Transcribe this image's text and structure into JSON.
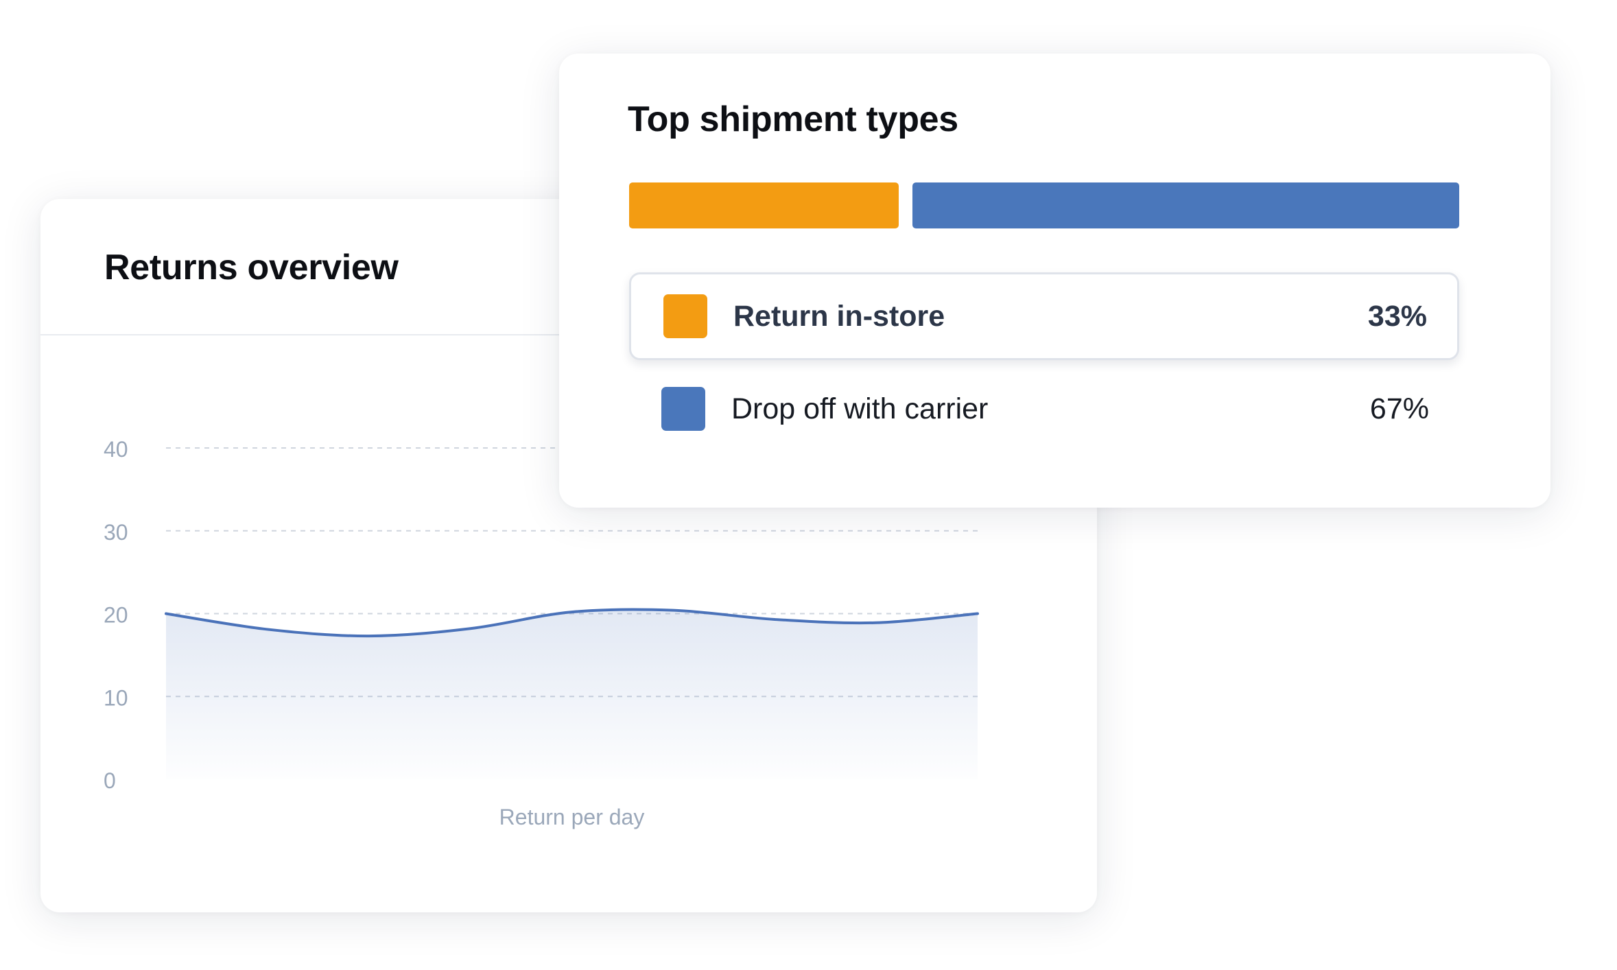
{
  "returns_overview": {
    "title": "Returns overview"
  },
  "chart_data": {
    "type": "area",
    "title": "Returns overview",
    "xlabel": "Return per day",
    "ylabel": "",
    "ylim": [
      0,
      40
    ],
    "yticks": [
      "40",
      "30",
      "20",
      "10",
      "0"
    ],
    "grid": true,
    "legend": "none",
    "line_color": "#4a72b9",
    "x": [
      0,
      1,
      2,
      3,
      4,
      5,
      6,
      7,
      8
    ],
    "series": [
      {
        "values": [
          20.0,
          18.1,
          17.3,
          18.2,
          20.2,
          20.4,
          19.3,
          18.9,
          20.0
        ]
      }
    ]
  },
  "shipment_types": {
    "title": "Top shipment types",
    "items": [
      {
        "label": "Return in-store",
        "percent": "33%",
        "share": 0.33,
        "color": "#f39c12"
      },
      {
        "label": "Drop off with carrier",
        "percent": "67%",
        "share": 0.67,
        "color": "#4a77bb"
      }
    ]
  }
}
